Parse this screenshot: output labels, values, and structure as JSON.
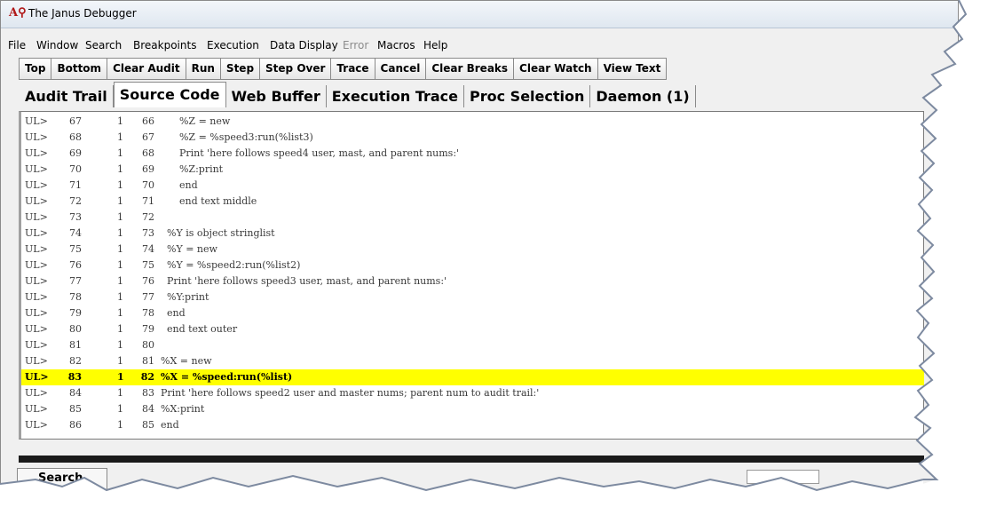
{
  "window": {
    "title": "The Janus Debugger"
  },
  "menu": [
    "File",
    "Window",
    "Search",
    "Breakpoints",
    "Execution",
    "Data Display",
    "Error",
    "Macros",
    "Help"
  ],
  "toolbar": [
    "Top",
    "Bottom",
    "Clear Audit",
    "Run",
    "Step",
    "Step Over",
    "Trace",
    "Cancel",
    "Clear Breaks",
    "Clear Watch",
    "View Text"
  ],
  "tabs": [
    "Audit Trail",
    "Source Code",
    "Web Buffer",
    "Execution Trace",
    "Proc Selection",
    "Daemon (1)"
  ],
  "active_tab": "Source Code",
  "code_lines": [
    {
      "prefix": "UL>",
      "line": "67",
      "level": "1",
      "src": "66",
      "text": "      %Z = new"
    },
    {
      "prefix": "UL>",
      "line": "68",
      "level": "1",
      "src": "67",
      "text": "      %Z = %speed3:run(%list3)"
    },
    {
      "prefix": "UL>",
      "line": "69",
      "level": "1",
      "src": "68",
      "text": "      Print 'here follows speed4 user, mast, and parent nums:'"
    },
    {
      "prefix": "UL>",
      "line": "70",
      "level": "1",
      "src": "69",
      "text": "      %Z:print"
    },
    {
      "prefix": "UL>",
      "line": "71",
      "level": "1",
      "src": "70",
      "text": "      end"
    },
    {
      "prefix": "UL>",
      "line": "72",
      "level": "1",
      "src": "71",
      "text": "      end text middle"
    },
    {
      "prefix": "UL>",
      "line": "73",
      "level": "1",
      "src": "72",
      "text": ""
    },
    {
      "prefix": "UL>",
      "line": "74",
      "level": "1",
      "src": "73",
      "text": "  %Y is object stringlist"
    },
    {
      "prefix": "UL>",
      "line": "75",
      "level": "1",
      "src": "74",
      "text": "  %Y = new"
    },
    {
      "prefix": "UL>",
      "line": "76",
      "level": "1",
      "src": "75",
      "text": "  %Y = %speed2:run(%list2)"
    },
    {
      "prefix": "UL>",
      "line": "77",
      "level": "1",
      "src": "76",
      "text": "  Print 'here follows speed3 user, mast, and parent nums:'"
    },
    {
      "prefix": "UL>",
      "line": "78",
      "level": "1",
      "src": "77",
      "text": "  %Y:print"
    },
    {
      "prefix": "UL>",
      "line": "79",
      "level": "1",
      "src": "78",
      "text": "  end"
    },
    {
      "prefix": "UL>",
      "line": "80",
      "level": "1",
      "src": "79",
      "text": "  end text outer"
    },
    {
      "prefix": "UL>",
      "line": "81",
      "level": "1",
      "src": "80",
      "text": ""
    },
    {
      "prefix": "UL>",
      "line": "82",
      "level": "1",
      "src": "81",
      "text": "%X = new"
    },
    {
      "prefix": "UL>",
      "line": "83",
      "level": "1",
      "src": "82",
      "text": "%X = %speed:run(%list)"
    },
    {
      "prefix": "UL>",
      "line": "84",
      "level": "1",
      "src": "83",
      "text": "Print 'here follows speed2 user and master nums; parent num to audit trail:'"
    },
    {
      "prefix": "UL>",
      "line": "85",
      "level": "1",
      "src": "84",
      "text": "%X:print"
    },
    {
      "prefix": "UL>",
      "line": "86",
      "level": "1",
      "src": "85",
      "text": "end"
    }
  ],
  "highlighted_line": "83",
  "highlight_color": "#ffff00",
  "bottom": {
    "search_tab": "Search"
  },
  "icons": {
    "app": "janus-debugger-logo-icon"
  }
}
